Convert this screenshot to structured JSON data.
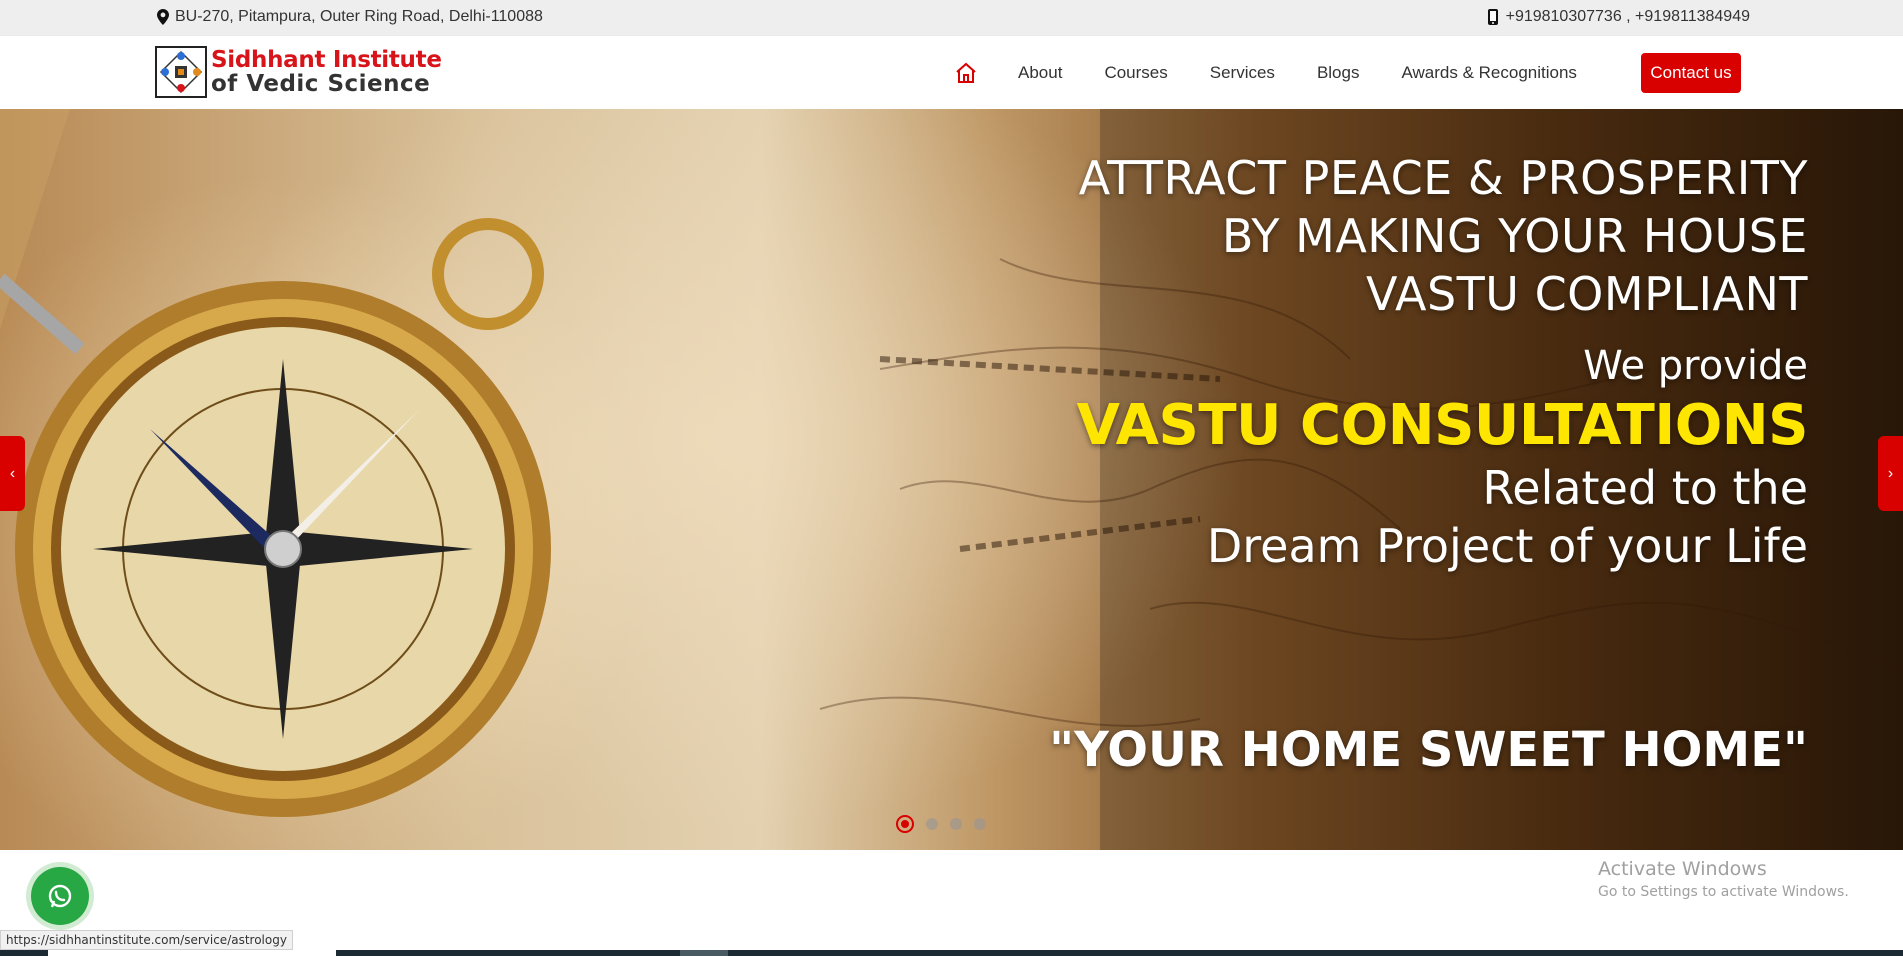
{
  "topbar": {
    "address": "BU-270, Pitampura, Outer Ring Road, Delhi-110088",
    "phones": "+919810307736 , +919811384949",
    "address_icon": "map-pin-icon",
    "phone_icon": "mobile-phone-icon"
  },
  "header": {
    "logo_line1": "Sidhhant Institute",
    "logo_line2": "of Vedic Science",
    "nav": {
      "home_icon": "home-icon",
      "about": "About",
      "courses": "Courses",
      "services": "Services",
      "blogs": "Blogs",
      "awards": "Awards & Recognitions",
      "contact": "Contact us"
    }
  },
  "hero": {
    "heading_line1": "ATTRACT PEACE & PROSPERITY",
    "heading_line2": "BY MAKING YOUR HOUSE",
    "heading_line3": "VASTU COMPLIANT",
    "provide": "We provide",
    "highlight": "VASTU CONSULTATIONS",
    "related": "Related to the",
    "dream": "Dream Project of your Life",
    "tagline": "\"YOUR HOME SWEET HOME\"",
    "prev_label": "‹",
    "next_label": "›",
    "slide_count": 4,
    "active_slide": 1
  },
  "whatsapp": {
    "icon": "whatsapp-icon"
  },
  "windows_notice": {
    "title": "Activate Windows",
    "subtitle": "Go to Settings to activate Windows."
  },
  "status_bar": {
    "url": "https://sidhhantinstitute.com/service/astrology"
  },
  "colors": {
    "accent": "#d90000",
    "highlight_yellow": "#ffe600",
    "topbar_bg": "#eeeeee",
    "whatsapp_green": "#28a745"
  }
}
